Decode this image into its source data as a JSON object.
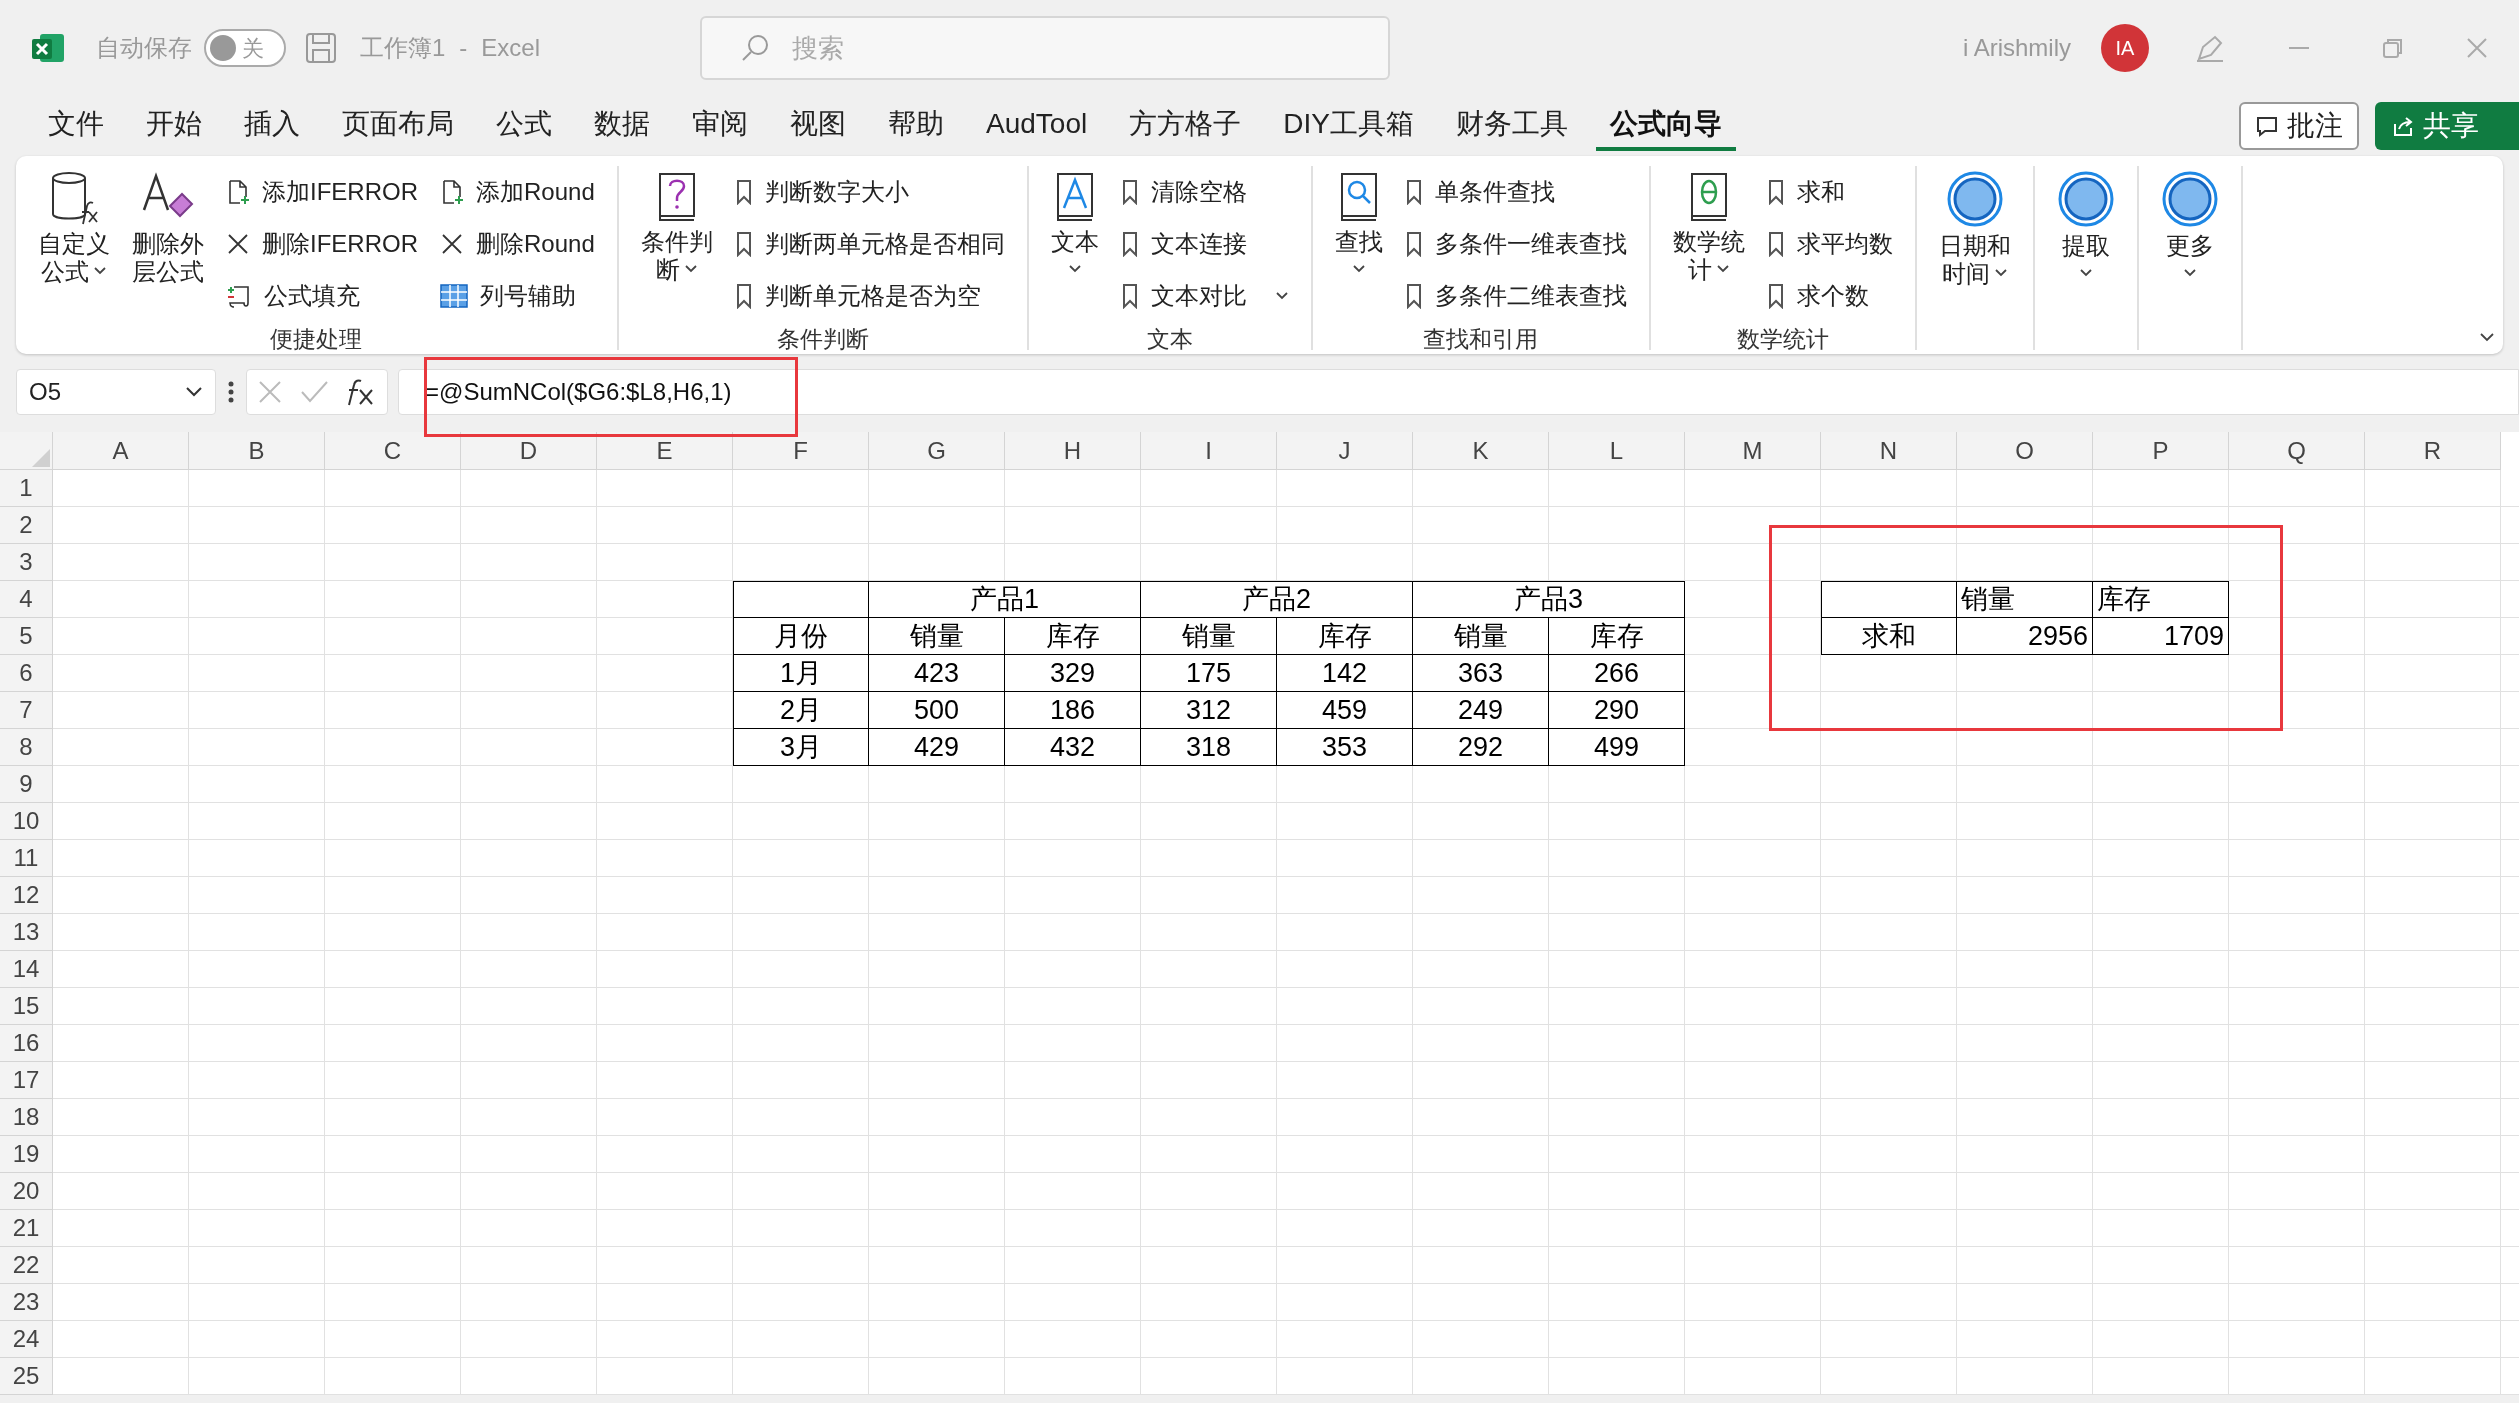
{
  "title_bar": {
    "autosave_label": "自动保存",
    "autosave_toggle": {
      "on": false,
      "label": "关"
    },
    "document_title": "工作簿1",
    "separator": "-",
    "app_name": "Excel",
    "search_placeholder": "搜索",
    "user_name": "i Arishmily",
    "avatar_initials": "IA"
  },
  "ribbon_tabs": [
    {
      "label": "文件",
      "selected": false
    },
    {
      "label": "开始",
      "selected": false
    },
    {
      "label": "插入",
      "selected": false
    },
    {
      "label": "页面布局",
      "selected": false
    },
    {
      "label": "公式",
      "selected": false
    },
    {
      "label": "数据",
      "selected": false
    },
    {
      "label": "审阅",
      "selected": false
    },
    {
      "label": "视图",
      "selected": false
    },
    {
      "label": "帮助",
      "selected": false
    },
    {
      "label": "AudTool",
      "selected": false
    },
    {
      "label": "方方格子",
      "selected": false
    },
    {
      "label": "DIY工具箱",
      "selected": false
    },
    {
      "label": "财务工具",
      "selected": false
    },
    {
      "label": "公式向导",
      "selected": true
    }
  ],
  "comment_button": "批注",
  "share_button": "共享",
  "ribbon_groups": [
    {
      "label": "便捷处理",
      "large": [
        {
          "kind": "cylinder",
          "lines": [
            "自定义",
            "公式"
          ],
          "dropdown": true
        },
        {
          "kind": "eraser",
          "lines": [
            "删除外",
            "层公式"
          ],
          "dropdown": false
        }
      ],
      "columns": [
        [
          {
            "kind": "add",
            "label": "添加IFERROR"
          },
          {
            "kind": "delete",
            "label": "删除IFERROR"
          },
          {
            "kind": "fill",
            "label": "公式填充"
          }
        ],
        [
          {
            "kind": "add",
            "label": "添加Round"
          },
          {
            "kind": "delete",
            "label": "删除Round"
          },
          {
            "kind": "grid",
            "label": "列号辅助"
          }
        ]
      ]
    },
    {
      "label": "条件判断",
      "large": [
        {
          "kind": "book-question",
          "lines": [
            "条件判",
            "断"
          ],
          "dropdown": true
        }
      ],
      "columns": [
        [
          {
            "kind": "bookmark",
            "label": "判断数字大小"
          },
          {
            "kind": "bookmark",
            "label": "判断两单元格是否相同"
          },
          {
            "kind": "bookmark",
            "label": "判断单元格是否为空",
            "dropdown": false
          }
        ]
      ]
    },
    {
      "label": "文本",
      "large": [
        {
          "kind": "book-a",
          "lines": [
            "文本"
          ],
          "dropdown": true
        }
      ],
      "columns": [
        [
          {
            "kind": "bookmark",
            "label": "清除空格"
          },
          {
            "kind": "bookmark",
            "label": "文本连接"
          },
          {
            "kind": "bookmark",
            "label": "文本对比",
            "dropdown": true
          }
        ]
      ]
    },
    {
      "label": "查找和引用",
      "large": [
        {
          "kind": "book-search",
          "lines": [
            "查找"
          ],
          "dropdown": true
        }
      ],
      "columns": [
        [
          {
            "kind": "bookmark",
            "label": "单条件查找"
          },
          {
            "kind": "bookmark",
            "label": "多条件一维表查找"
          },
          {
            "kind": "bookmark",
            "label": "多条件二维表查找"
          }
        ]
      ]
    },
    {
      "label": "数学统计",
      "large": [
        {
          "kind": "book-theta",
          "lines": [
            "数学统",
            "计"
          ],
          "dropdown": true
        }
      ],
      "columns": [
        [
          {
            "kind": "bookmark",
            "label": "求和"
          },
          {
            "kind": "bookmark",
            "label": "求平均数"
          },
          {
            "kind": "bookmark",
            "label": "求个数"
          }
        ]
      ]
    },
    {
      "large": [
        {
          "kind": "circle",
          "lines": [
            "日期和",
            "时间"
          ],
          "dropdown": true
        }
      ]
    },
    {
      "large": [
        {
          "kind": "circle",
          "lines": [
            "提取"
          ],
          "dropdown": true
        }
      ]
    },
    {
      "large": [
        {
          "kind": "circle",
          "lines": [
            "更多"
          ],
          "dropdown": true
        }
      ]
    }
  ],
  "formula_bar": {
    "name_box": "O5",
    "formula": "=@SumNCol($G6:$L8,H6,1)"
  },
  "sheet": {
    "columns": [
      "A",
      "B",
      "C",
      "D",
      "E",
      "F",
      "G",
      "H",
      "I",
      "J",
      "K",
      "L",
      "M",
      "N",
      "O",
      "P",
      "Q",
      "R"
    ],
    "rows": [
      "1",
      "2",
      "3",
      "4",
      "5",
      "6",
      "7",
      "8",
      "9",
      "10",
      "11",
      "12",
      "13",
      "14",
      "15",
      "16",
      "17",
      "18",
      "19",
      "20",
      "21",
      "22",
      "23",
      "24",
      "25"
    ],
    "tables": [
      {
        "kind": "product-table",
        "groups": [
          "产品1",
          "产品2",
          "产品3"
        ],
        "header": [
          "月份",
          "销量",
          "库存",
          "销量",
          "库存",
          "销量",
          "库存"
        ],
        "rows": [
          [
            "1月",
            "423",
            "329",
            "175",
            "142",
            "363",
            "266"
          ],
          [
            "2月",
            "500",
            "186",
            "312",
            "459",
            "249",
            "290"
          ],
          [
            "3月",
            "429",
            "432",
            "318",
            "353",
            "292",
            "499"
          ]
        ]
      },
      {
        "kind": "summary-table",
        "header": [
          "销量",
          "库存"
        ],
        "rows": [
          [
            "求和",
            "2956",
            "1709"
          ]
        ]
      }
    ]
  }
}
